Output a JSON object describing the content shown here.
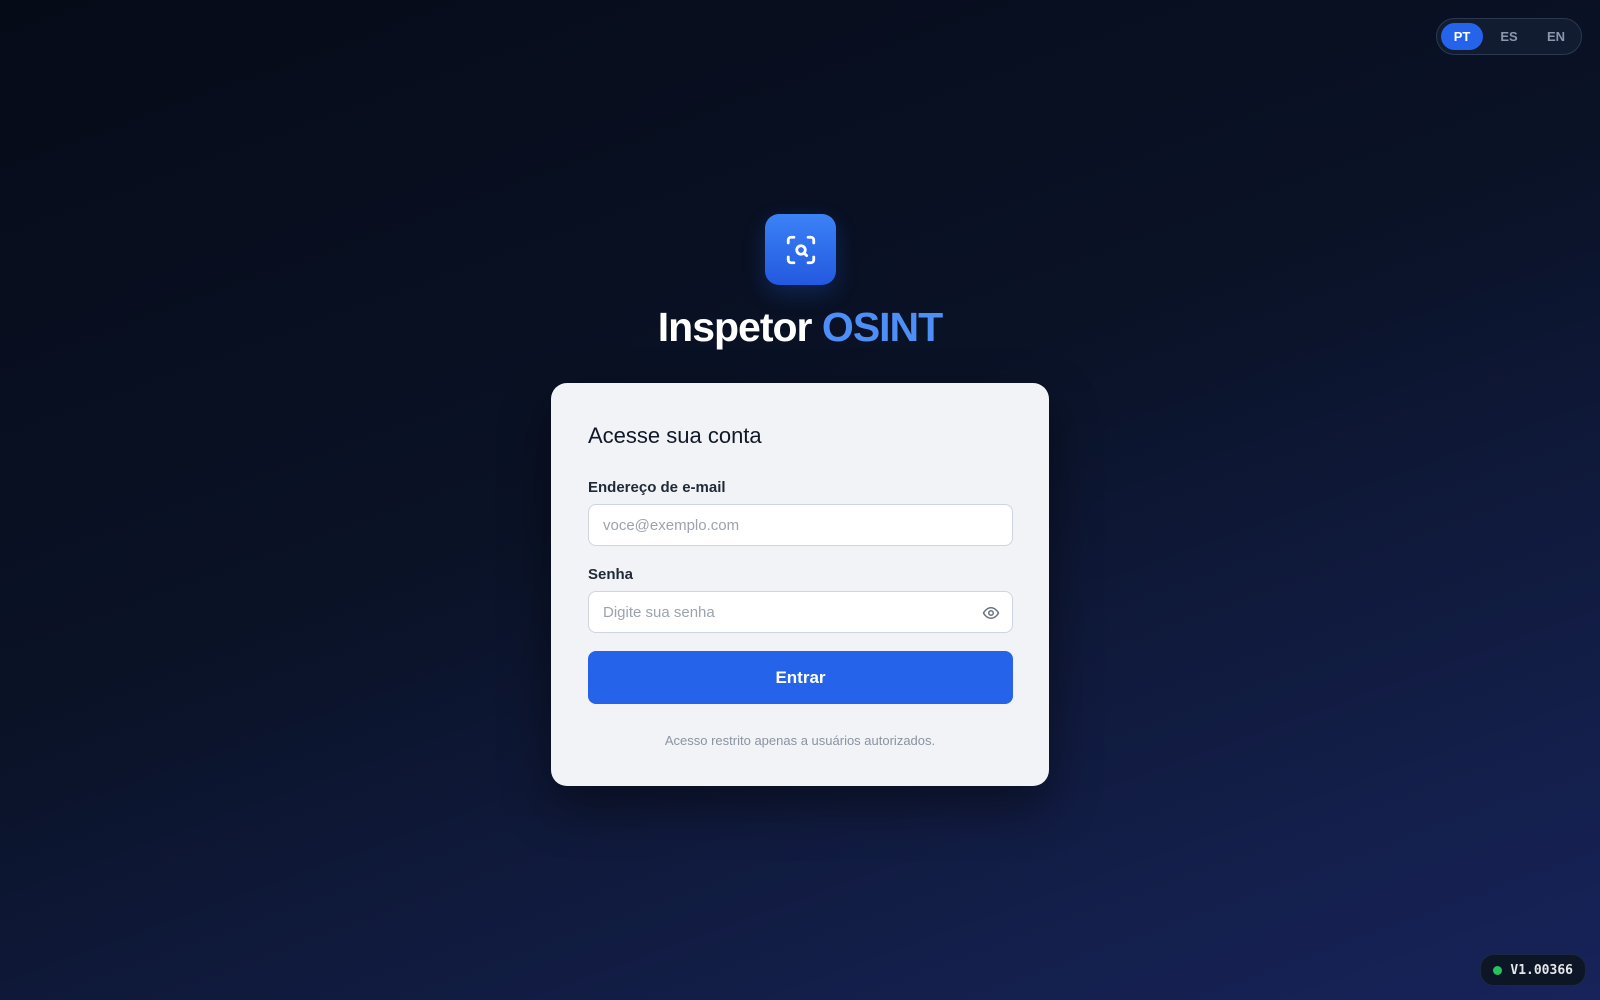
{
  "language_switcher": {
    "options": [
      {
        "label": "PT",
        "active": true
      },
      {
        "label": "ES",
        "active": false
      },
      {
        "label": "EN",
        "active": false
      }
    ]
  },
  "brand": {
    "logo_icon": "scan-search-icon",
    "title_main": "Inspetor",
    "title_accent": "OSINT",
    "accent_color": "#4d8ef7",
    "logo_color": "#2563eb"
  },
  "login_card": {
    "heading": "Acesse sua conta",
    "email": {
      "label": "Endereço de e-mail",
      "value": "",
      "placeholder": "voce@exemplo.com"
    },
    "password": {
      "label": "Senha",
      "value": "",
      "placeholder": "Digite sua senha",
      "toggle_icon": "eye-icon"
    },
    "submit_label": "Entrar",
    "footnote": "Acesso restrito apenas a usuários autorizados."
  },
  "version_badge": {
    "status_color": "#22c55e",
    "version": "V1.00366"
  },
  "colors": {
    "primary": "#2563eb",
    "card_background": "#f1f3f6",
    "page_background": "#0a1226"
  }
}
